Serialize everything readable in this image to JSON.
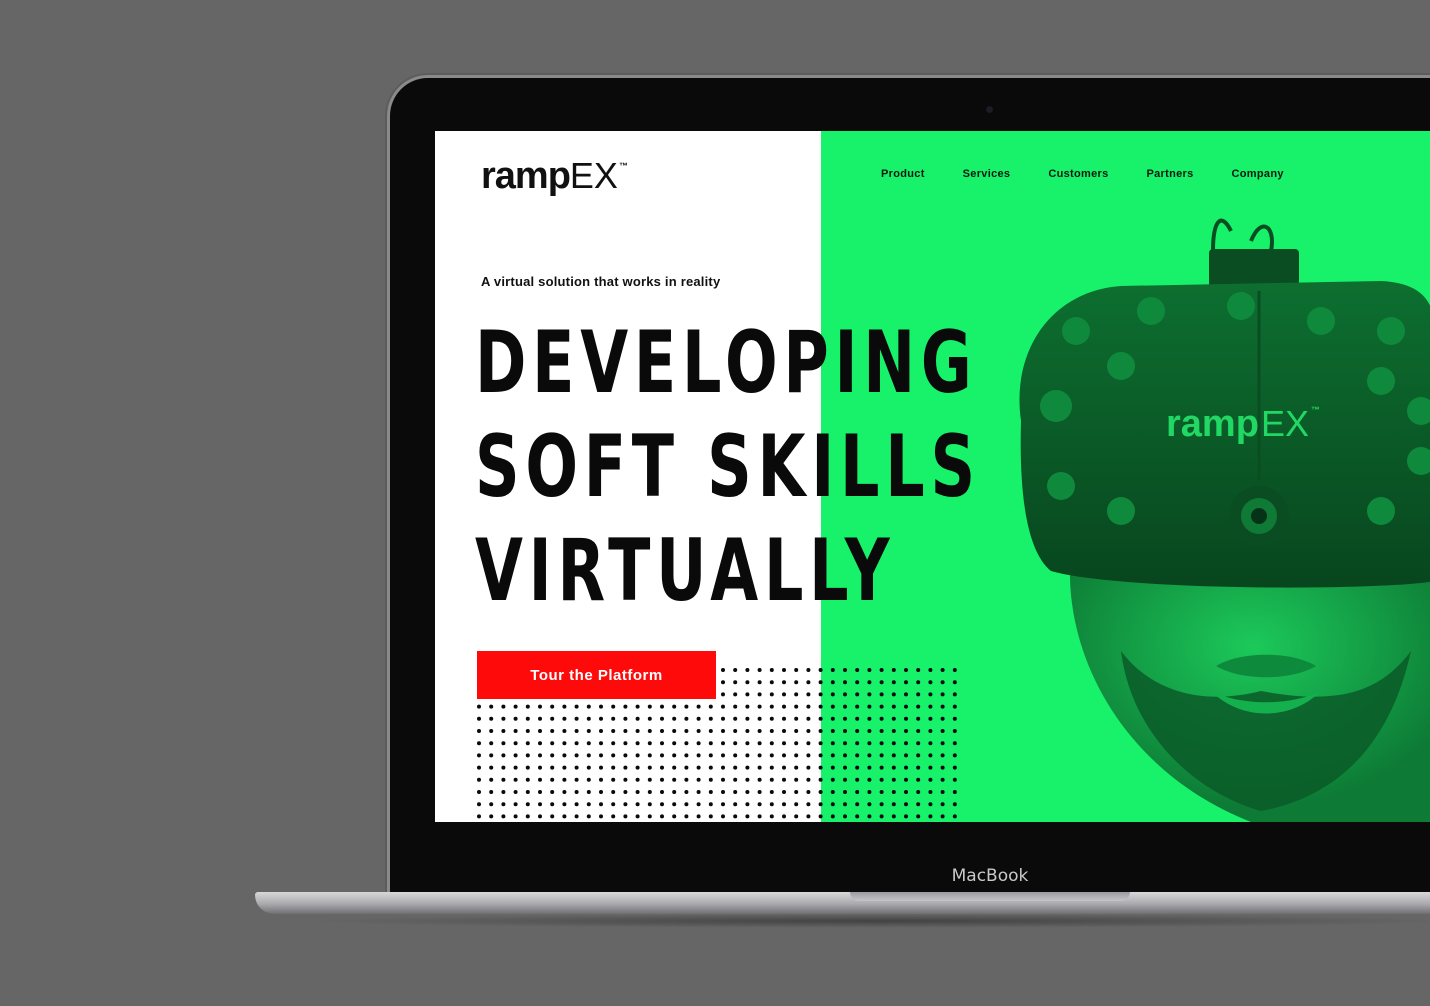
{
  "device": {
    "label": "MacBook"
  },
  "site": {
    "logo": {
      "primary": "ramp",
      "secondary": "EX",
      "trademark": "™"
    },
    "nav": [
      {
        "label": "Product"
      },
      {
        "label": "Services"
      },
      {
        "label": "Customers"
      },
      {
        "label": "Partners"
      },
      {
        "label": "Company"
      }
    ],
    "hero": {
      "tagline": "A virtual solution that works in reality",
      "headline_lines": [
        "DEVELOPING",
        "SOFT SKILLS",
        "VIRTUALLY"
      ],
      "cta_label": "Tour the Platform"
    },
    "headset": {
      "logo_primary": "ramp",
      "logo_secondary": "EX",
      "logo_trademark": "™"
    }
  },
  "colors": {
    "background": "#666666",
    "green": "#17f26a",
    "cta_red": "#ff0a0a",
    "text": "#0a0a0a"
  },
  "icons": [
    "laptop-camera-icon"
  ]
}
